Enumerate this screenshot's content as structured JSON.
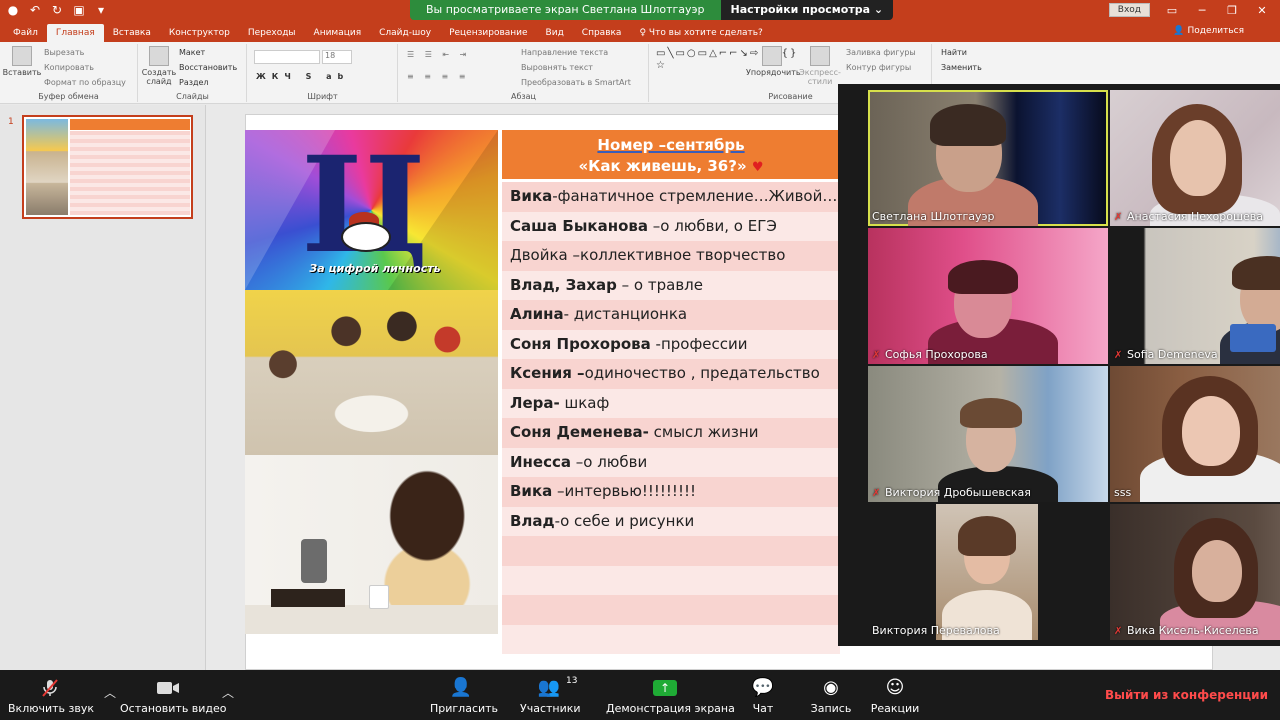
{
  "titlebar": {
    "banner_text": "Вы просматриваете экран Светлана Шлотгауэр",
    "view_options": "Настройки просмотра ⌄",
    "signin": "Вход"
  },
  "ribbon": {
    "tabs": [
      "Файл",
      "Главная",
      "Вставка",
      "Конструктор",
      "Переходы",
      "Анимация",
      "Слайд-шоу",
      "Рецензирование",
      "Вид",
      "Справка"
    ],
    "search": "Что вы хотите сделать?",
    "share": "Поделиться",
    "paste": "Вставить",
    "cut": "Вырезать",
    "copy": "Копировать",
    "format_painter": "Формат по образцу",
    "clipboard": "Буфер обмена",
    "new_slide": "Создать слайд",
    "layout": "Макет",
    "reset": "Восстановить",
    "section": "Раздел",
    "slides_group": "Слайды",
    "font_group": "Шрифт",
    "font_size": "18",
    "text_direction": "Направление текста",
    "align_text": "Выровнять текст",
    "smartart": "Преобразовать в SmartArt",
    "paragraph_group": "Абзац",
    "arrange": "Упорядочить",
    "quick_styles": "Экспресс-стили",
    "shape_fill": "Заливка фигуры",
    "shape_outline": "Контур фигуры",
    "drawing_group": "Рисование",
    "find": "Найти",
    "replace": "Заменить"
  },
  "slide_panel": {
    "slide_number": "1"
  },
  "slide": {
    "logo_letter": "Ц",
    "logo_caption": "За цифрой личность",
    "header_line1": "Номер –сентябрь",
    "header_line2": "«Как живешь, 36?»",
    "heart": "♥",
    "rows": [
      {
        "bold": "Вика",
        "text": "-фанатичное стремление…Живой…"
      },
      {
        "bold": "Саша Быканова",
        "text": " –о любви, о ЕГЭ"
      },
      {
        "bold": "",
        "text": "Двойка –коллективное творчество"
      },
      {
        "bold": "Влад, Захар",
        "text": " – о травле"
      },
      {
        "bold": "Алина",
        "text": "- дистанционка"
      },
      {
        "bold": "Соня Прохорова",
        "text": " -профессии"
      },
      {
        "bold": "Ксения –",
        "text": "одиночество , предательство"
      },
      {
        "bold": "Лера-",
        "text": " шкаф"
      },
      {
        "bold": "Соня Деменева-",
        "text": " смысл жизни"
      },
      {
        "bold": "Инесса",
        "text": " –о любви"
      },
      {
        "bold": "Вика",
        "text": " –интервью!!!!!!!!!"
      },
      {
        "bold": "Влад",
        "text": "-о себе и рисунки"
      },
      {
        "bold": "",
        "text": ""
      },
      {
        "bold": "",
        "text": ""
      },
      {
        "bold": "",
        "text": ""
      },
      {
        "bold": "",
        "text": ""
      }
    ]
  },
  "gallery": {
    "participants": [
      {
        "name": "Светлана Шлотгауэр",
        "muted": false
      },
      {
        "name": "Анастасия Нехорошева",
        "muted": true
      },
      {
        "name": "Софья Прохорова",
        "muted": true
      },
      {
        "name": "Sofia Demeneva",
        "muted": true
      },
      {
        "name": "Виктория Дробышевская",
        "muted": true
      },
      {
        "name": "sss",
        "muted": false
      },
      {
        "name": "Виктория Перевалова",
        "muted": false
      },
      {
        "name": "Вика Кисель-Киселева",
        "muted": true
      }
    ]
  },
  "zoombar": {
    "unmute": "Включить звук",
    "stop_video": "Остановить видео",
    "invite": "Пригласить",
    "participants": "Участники",
    "participants_count": "13",
    "share_screen": "Демонстрация экрана",
    "chat": "Чат",
    "record": "Запись",
    "reactions": "Реакции",
    "leave": "Выйти из конференции"
  }
}
